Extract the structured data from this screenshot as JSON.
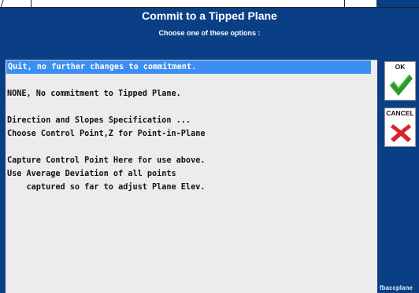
{
  "dialog": {
    "title": "Commit to a Tipped Plane",
    "subtitle": "Choose one of these options :"
  },
  "options": [
    "Quit, no further changes to commitment.",
    "",
    "NONE, No commitment to Tipped Plane.",
    "",
    "Direction and Slopes Specification ...",
    "Choose Control Point,Z for Point-in-Plane",
    "",
    "Capture Control Point Here for use above.",
    "Use Average Deviation of all points",
    "    captured so far to adjust Plane Elev."
  ],
  "selected_index": 0,
  "buttons": {
    "ok_label": "OK",
    "cancel_label": "CANCEL"
  },
  "footer": "fbaccplane",
  "colors": {
    "background": "#0a3f86",
    "selection": "#3d8ef2",
    "ok_check": "#2e9a2e",
    "cancel_x": "#d7262b"
  }
}
